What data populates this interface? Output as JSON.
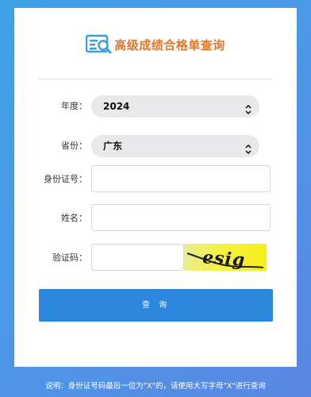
{
  "header": {
    "title": "高级成绩合格单查询",
    "logo_icon": "search-document-icon"
  },
  "form": {
    "year": {
      "label": "年度：",
      "value": "2024"
    },
    "province": {
      "label": "省份：",
      "value": "广东"
    },
    "id_number": {
      "label": "身份证号：",
      "value": ""
    },
    "name": {
      "label": "姓名：",
      "value": ""
    },
    "captcha": {
      "label": "验证码：",
      "value": "",
      "image_text": "esig"
    }
  },
  "submit_label": "查 询",
  "footer_note": "说明：身份证号码最后一位为\"X\"的，请使用大写字母\"X\"进行查询",
  "colors": {
    "accent": "#2b86dd",
    "title": "#e4762a",
    "background": "#4f94e6"
  }
}
